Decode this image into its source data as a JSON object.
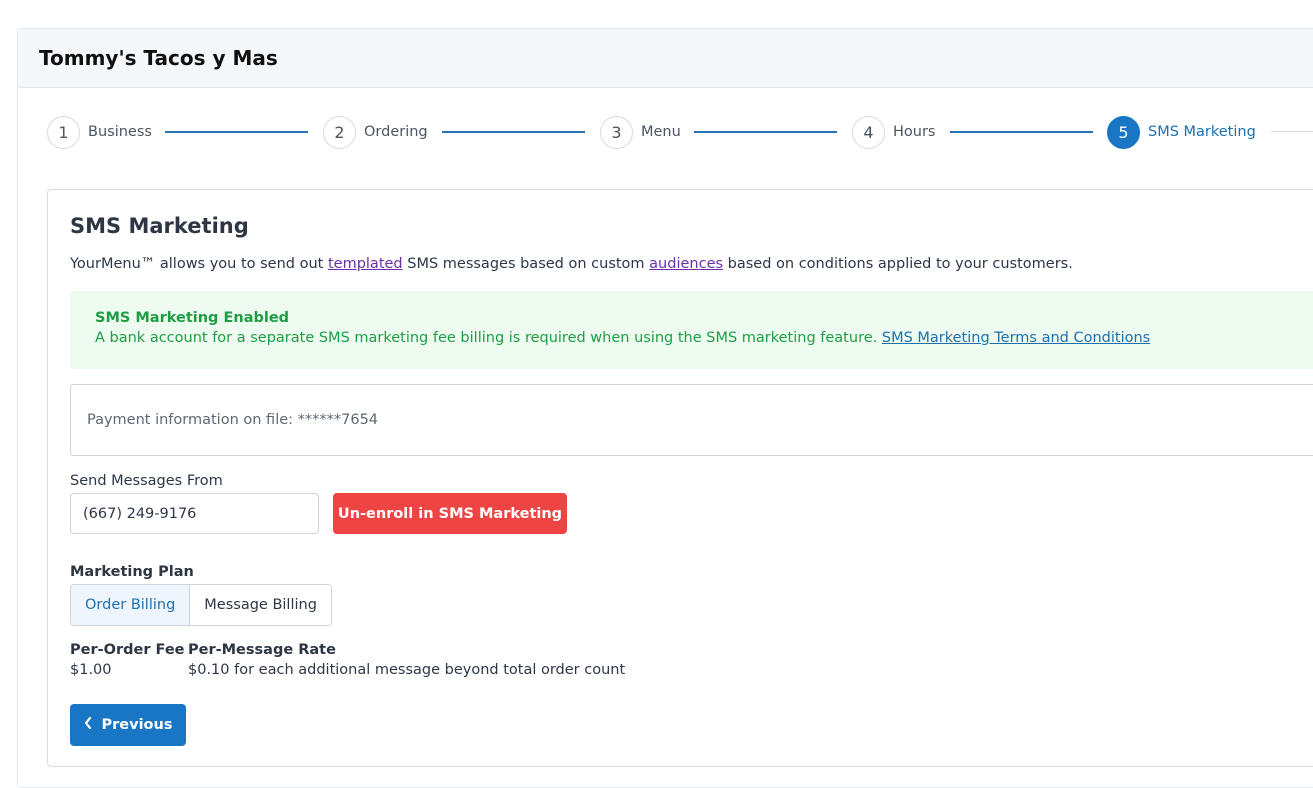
{
  "header": {
    "title": "Tommy's Tacos y Mas"
  },
  "stepper": {
    "steps": [
      {
        "number": "1",
        "label": "Business"
      },
      {
        "number": "2",
        "label": "Ordering"
      },
      {
        "number": "3",
        "label": "Menu"
      },
      {
        "number": "4",
        "label": "Hours"
      },
      {
        "number": "5",
        "label": "SMS Marketing"
      }
    ],
    "active_step": "5"
  },
  "card": {
    "title": "SMS Marketing",
    "desc_prefix": "YourMenu™ allows you to send out ",
    "desc_link1": "templated",
    "desc_mid": " SMS messages based on custom ",
    "desc_link2": "audiences",
    "desc_suffix": " based on conditions applied to your customers."
  },
  "alert": {
    "title": "SMS Marketing Enabled",
    "text": "A bank account for a separate SMS marketing fee billing is required when using the SMS marketing feature. ",
    "link": "SMS Marketing Terms and Conditions"
  },
  "payment": {
    "text": "Payment information on file: ******7654"
  },
  "send_from": {
    "label": "Send Messages From",
    "value": "(667) 249-9176",
    "unenroll_label": "Un-enroll in SMS Marketing"
  },
  "plan": {
    "label": "Marketing Plan",
    "options": [
      "Order Billing",
      "Message Billing"
    ],
    "selected": "Order Billing"
  },
  "fees": {
    "per_order_label": "Per-Order Fee",
    "per_order_value": "$1.00",
    "per_message_label": "Per-Message Rate",
    "per_message_value": "$0.10 for each additional message beyond total order count"
  },
  "nav": {
    "previous_label": "Previous"
  },
  "colors": {
    "primary": "#1976c5",
    "danger": "#ef4444",
    "success_text": "#1e9e43",
    "success_bg": "#eefbf1"
  }
}
